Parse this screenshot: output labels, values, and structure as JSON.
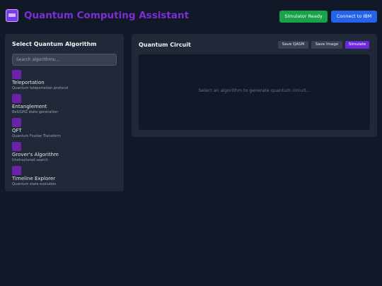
{
  "header": {
    "title": "Quantum Computing Assistant",
    "status_label": "Simulator Ready",
    "connect_label": "Connect to IBM"
  },
  "algorithms_panel": {
    "title": "Select Quantum Algorithm",
    "search_placeholder": "Search algorithms...",
    "items": [
      {
        "name": "Teleportation",
        "description": "Quantum teleportation protocol"
      },
      {
        "name": "Entanglement",
        "description": "Bell/GHZ state generation"
      },
      {
        "name": "QFT",
        "description": "Quantum Fourier Transform"
      },
      {
        "name": "Grover's Algorithm",
        "description": "Unstructured search"
      },
      {
        "name": "Timeline Explorer",
        "description": "Quantum state evolution"
      }
    ]
  },
  "circuit_panel": {
    "title": "Quantum Circuit",
    "save_qasm_label": "Save QASM",
    "save_image_label": "Save Image",
    "simulate_label": "Simulate",
    "placeholder": "Select an algorithm to generate quantum circuit..."
  },
  "colors": {
    "background": "#111827",
    "panel": "#1f2937",
    "title_accent": "#7c2fd6",
    "status_green": "#16a34a",
    "connect_blue": "#2563eb",
    "simulate_purple": "#6d28d9",
    "algorithm_icon": "#6b21a8"
  }
}
